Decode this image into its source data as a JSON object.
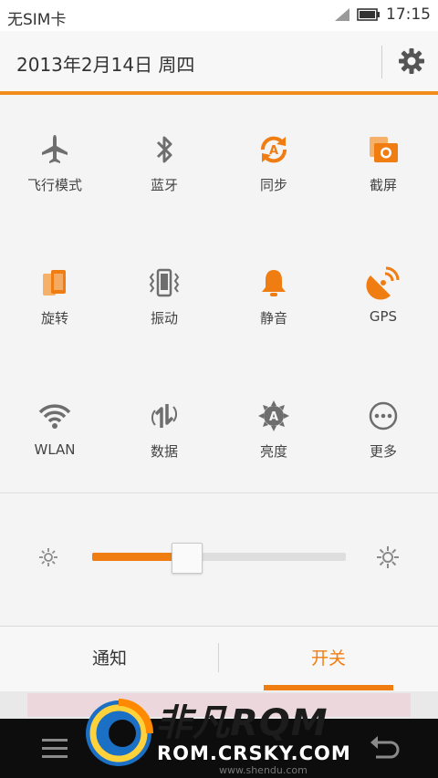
{
  "status": {
    "carrier": "无SIM卡",
    "time": "17:15"
  },
  "header": {
    "date": "2013年2月14日 周四",
    "settings_icon": "gear-icon"
  },
  "toggles": [
    {
      "label": "飞行模式",
      "icon": "airplane-icon",
      "active": false
    },
    {
      "label": "蓝牙",
      "icon": "bluetooth-icon",
      "active": false
    },
    {
      "label": "同步",
      "icon": "sync-icon",
      "active": true
    },
    {
      "label": "截屏",
      "icon": "screenshot-icon",
      "active": true
    },
    {
      "label": "旋转",
      "icon": "rotate-icon",
      "active": true
    },
    {
      "label": "振动",
      "icon": "vibrate-icon",
      "active": false
    },
    {
      "label": "静音",
      "icon": "bell-icon",
      "active": true
    },
    {
      "label": "GPS",
      "icon": "gps-icon",
      "active": true
    },
    {
      "label": "WLAN",
      "icon": "wifi-icon",
      "active": false
    },
    {
      "label": "数据",
      "icon": "data-icon",
      "active": false
    },
    {
      "label": "亮度",
      "icon": "auto-brightness-icon",
      "active": false
    },
    {
      "label": "更多",
      "icon": "more-icon",
      "active": false
    }
  ],
  "brightness": {
    "level": 0.37,
    "min_icon": "sun-small-icon",
    "max_icon": "sun-large-icon"
  },
  "tabs": [
    {
      "label": "通知",
      "active": false
    },
    {
      "label": "开关",
      "active": true
    }
  ],
  "watermark": {
    "brand": "非凡RQM",
    "url": "ROM.CRSKY.COM",
    "small": "www.shendu.com"
  },
  "colors": {
    "accent": "#f07d12",
    "inactive_icon": "#6e6e6e",
    "navbar": "#0d0d0d"
  }
}
